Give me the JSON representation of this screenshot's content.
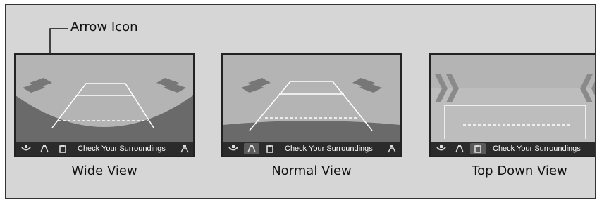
{
  "callout": {
    "label": "Arrow Icon"
  },
  "views": [
    {
      "caption": "Wide View",
      "status_text": "Check Your Surroundings",
      "active_icon": 0
    },
    {
      "caption": "Normal View",
      "status_text": "Check Your Surroundings",
      "active_icon": 1
    },
    {
      "caption": "Top Down View",
      "status_text": "Check Your Surroundings",
      "active_icon": 2
    }
  ],
  "icons": {
    "view_mode_icons": [
      "wide-view-icon",
      "normal-view-icon",
      "top-down-view-icon"
    ],
    "guideline_icon": "guideline-toggle-icon",
    "arrow_icon": "arrow-icon"
  },
  "colors": {
    "background": "#d6d6d6",
    "screen_sky": "#b4b4b4",
    "screen_ground": "#6a6a6a",
    "status_bar": "#2b2b2b",
    "guide_lines": "#ffffff"
  }
}
